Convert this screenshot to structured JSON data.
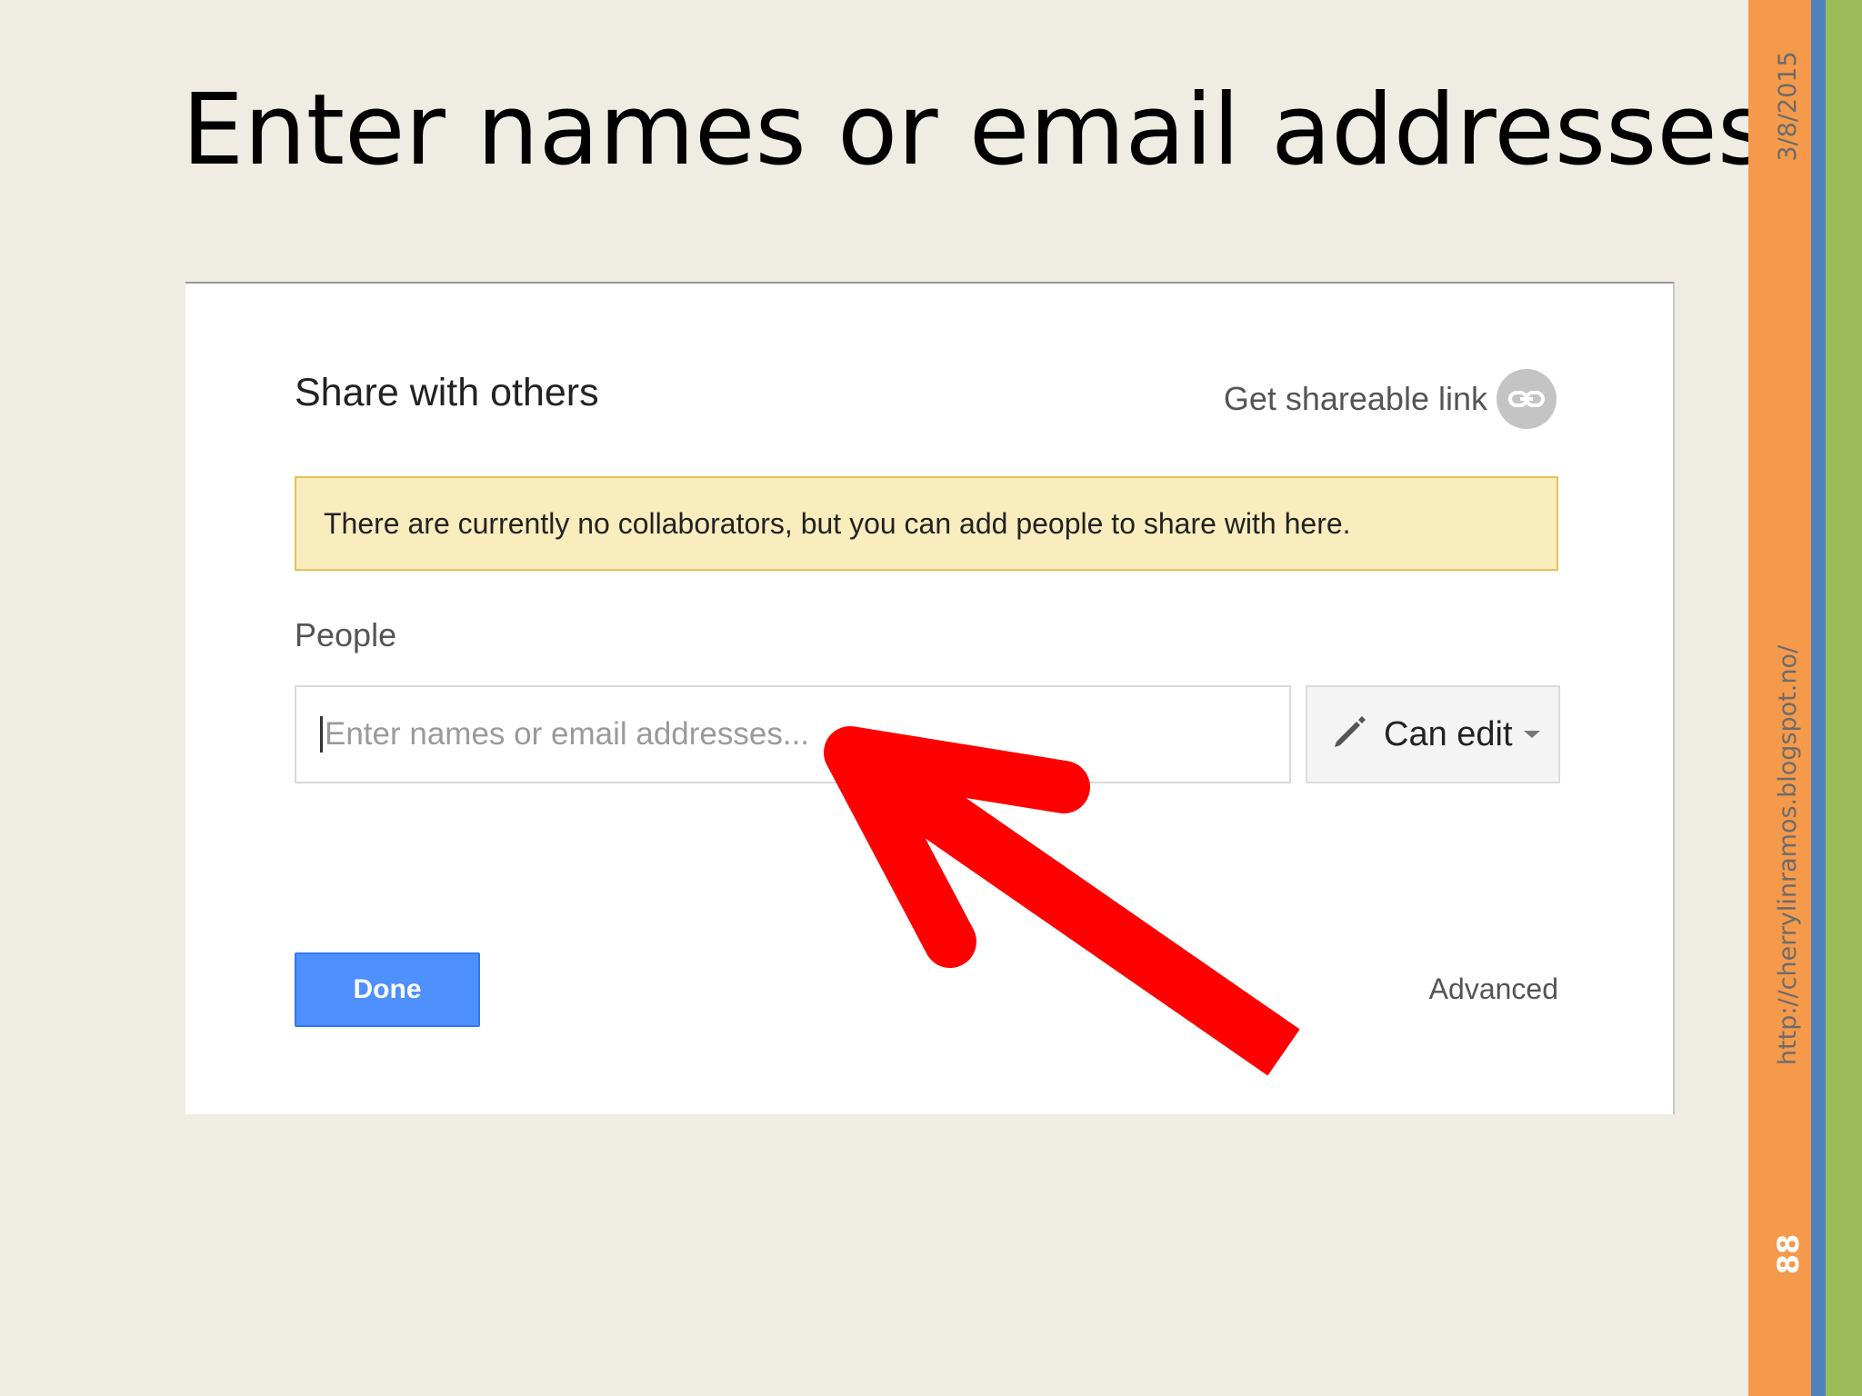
{
  "slide": {
    "title": "Enter names or email addresses",
    "date": "3/8/2015",
    "url": "http://cherrylinramos.blogspot.no/",
    "page_number": "88"
  },
  "dialog": {
    "title": "Share with others",
    "shareable_link_label": "Get shareable link",
    "notice": "There are currently no collaborators, but you can add people to share with here.",
    "people_label": "People",
    "input_placeholder": "Enter names or email addresses...",
    "permission_label": "Can edit",
    "done_label": "Done",
    "advanced_label": "Advanced"
  },
  "colors": {
    "done_blue": "#4d90fe",
    "notice_yellow": "#f9edbe",
    "arrow_red": "#ff0000",
    "bar_orange": "#f5994b",
    "bar_blue": "#4f81bd",
    "bar_green": "#9bbb59"
  },
  "icons": {
    "shareable": "link-icon",
    "permission": "pencil-icon",
    "dropdown": "chevron-down-icon",
    "annotation": "red-arrow-icon"
  }
}
